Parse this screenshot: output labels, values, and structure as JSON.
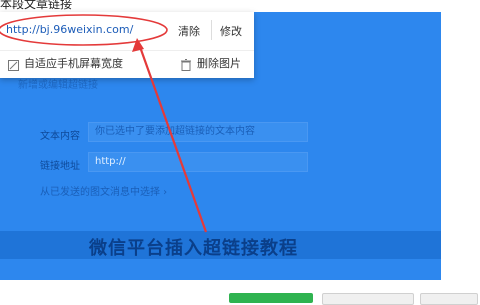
{
  "dialog": {
    "title": "本段文章链接",
    "subtitle": "新增或编辑超链接",
    "text_label": "文本内容",
    "text_value": "你已选中了要添加超链接的文本内容",
    "url_label": "链接地址",
    "url_value": "http://",
    "select_link": "从已发送的图文消息中选择 ›"
  },
  "popup": {
    "url": "http://bj.96weixin.com/",
    "clear": "清除",
    "edit": "修改",
    "auto_fit": "自适应手机屏幕宽度",
    "delete_image": "删除图片"
  },
  "banner": {
    "text": "微信平台插入超链接教程"
  },
  "colors": {
    "overlay_blue": "#2d87ee",
    "annotation_red": "#e43a3a",
    "confirm_green": "#2fb350"
  }
}
